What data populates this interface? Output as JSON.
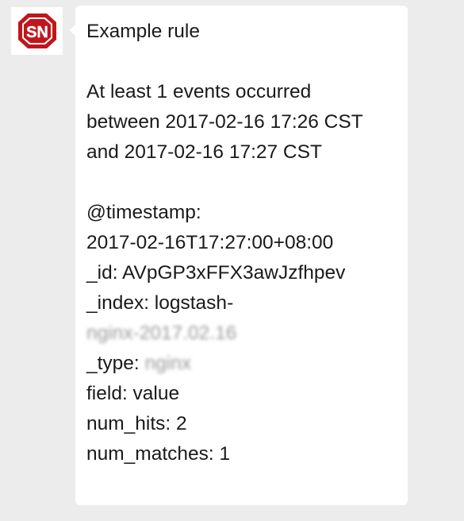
{
  "sender": {
    "avatar_icon": "sn-logo-icon",
    "avatar_text": "SN",
    "brand_color": "#c0161c"
  },
  "message": {
    "title": "Example rule",
    "summary_line1": "At least 1 events occurred",
    "summary_line2": "between 2017-02-16 17:26 CST",
    "summary_line3": "and 2017-02-16 17:27 CST",
    "timestamp_key": "@timestamp:",
    "timestamp_value": "2017-02-16T17:27:00+08:00",
    "id_line": "_id: AVpGP3xFFX3awJzfhpev",
    "index_line": "_index: logstash-",
    "index_value_redacted": "nginx-2017.02.16",
    "type_label": "_type: ",
    "type_value_redacted": "nginx",
    "field_line": "field: value",
    "num_hits_line": "num_hits: 2",
    "num_matches_line": "num_matches: 1"
  }
}
